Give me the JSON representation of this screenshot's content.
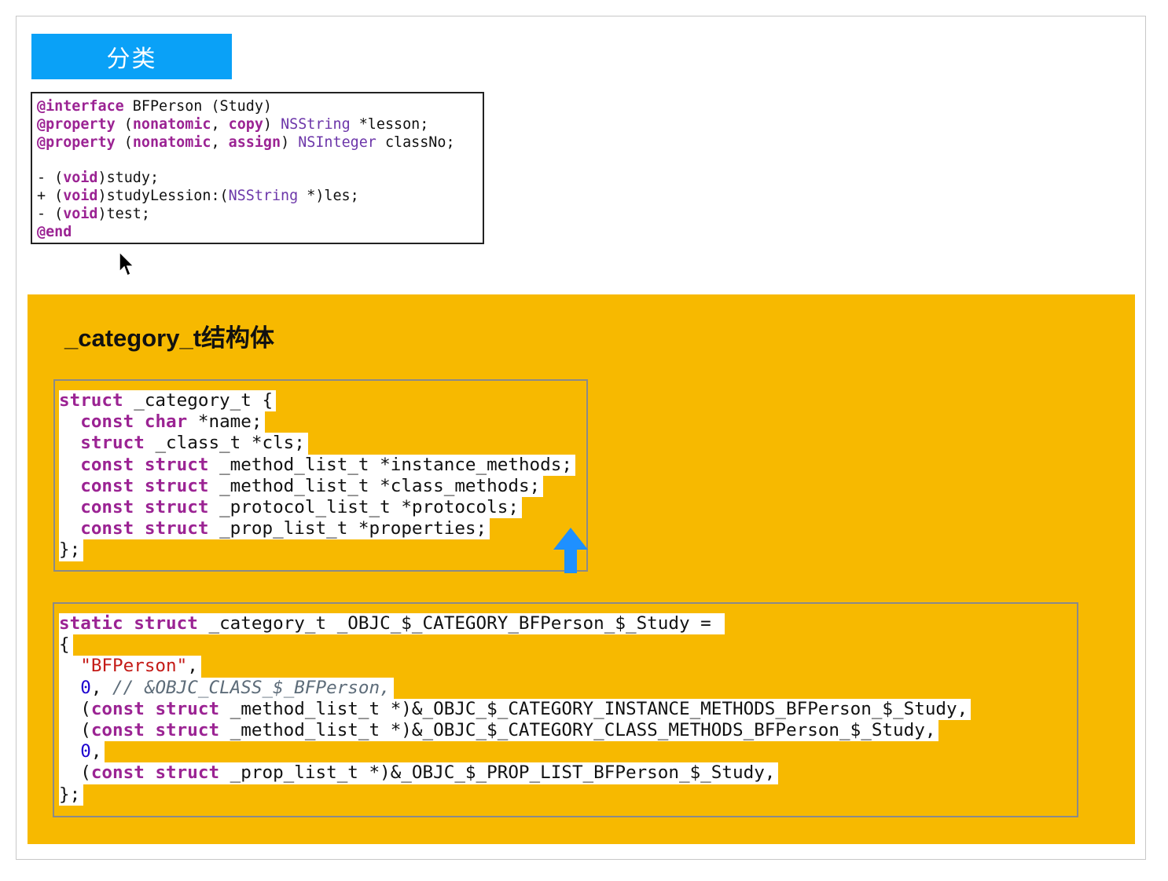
{
  "title_tag": "分类",
  "interface_code": [
    [
      {
        "t": "@interface",
        "c": "kw"
      },
      {
        "t": " BFPerson (Study)",
        "c": ""
      }
    ],
    [
      {
        "t": "@property",
        "c": "kw"
      },
      {
        "t": " (",
        "c": ""
      },
      {
        "t": "nonatomic",
        "c": "kw"
      },
      {
        "t": ", ",
        "c": ""
      },
      {
        "t": "copy",
        "c": "kw"
      },
      {
        "t": ") ",
        "c": ""
      },
      {
        "t": "NSString",
        "c": "ty"
      },
      {
        "t": " *lesson;",
        "c": ""
      }
    ],
    [
      {
        "t": "@property",
        "c": "kw"
      },
      {
        "t": " (",
        "c": ""
      },
      {
        "t": "nonatomic",
        "c": "kw"
      },
      {
        "t": ", ",
        "c": ""
      },
      {
        "t": "assign",
        "c": "kw"
      },
      {
        "t": ") ",
        "c": ""
      },
      {
        "t": "NSInteger",
        "c": "ty"
      },
      {
        "t": " classNo;",
        "c": ""
      }
    ],
    [],
    [
      {
        "t": "- (",
        "c": ""
      },
      {
        "t": "void",
        "c": "kw"
      },
      {
        "t": ")study;",
        "c": ""
      }
    ],
    [
      {
        "t": "+ (",
        "c": ""
      },
      {
        "t": "void",
        "c": "kw"
      },
      {
        "t": ")studyLession:(",
        "c": ""
      },
      {
        "t": "NSString",
        "c": "ty"
      },
      {
        "t": " *)les;",
        "c": ""
      }
    ],
    [
      {
        "t": "- (",
        "c": ""
      },
      {
        "t": "void",
        "c": "kw"
      },
      {
        "t": ")test;",
        "c": ""
      }
    ],
    [
      {
        "t": "@end",
        "c": "kw"
      }
    ]
  ],
  "panel_title": "_category_t结构体",
  "struct_code": [
    [
      {
        "t": "struct",
        "c": "kw"
      },
      {
        "t": " _category_t {",
        "c": ""
      }
    ],
    [
      {
        "t": "  ",
        "c": ""
      },
      {
        "t": "const",
        "c": "kw"
      },
      {
        "t": " ",
        "c": ""
      },
      {
        "t": "char",
        "c": "kw"
      },
      {
        "t": " *name;",
        "c": ""
      }
    ],
    [
      {
        "t": "  ",
        "c": ""
      },
      {
        "t": "struct",
        "c": "kw"
      },
      {
        "t": " _class_t *cls;",
        "c": ""
      }
    ],
    [
      {
        "t": "  ",
        "c": ""
      },
      {
        "t": "const",
        "c": "kw"
      },
      {
        "t": " ",
        "c": ""
      },
      {
        "t": "struct",
        "c": "kw"
      },
      {
        "t": " _method_list_t *instance_methods;",
        "c": ""
      }
    ],
    [
      {
        "t": "  ",
        "c": ""
      },
      {
        "t": "const",
        "c": "kw"
      },
      {
        "t": " ",
        "c": ""
      },
      {
        "t": "struct",
        "c": "kw"
      },
      {
        "t": " _method_list_t *class_methods;",
        "c": ""
      }
    ],
    [
      {
        "t": "  ",
        "c": ""
      },
      {
        "t": "const",
        "c": "kw"
      },
      {
        "t": " ",
        "c": ""
      },
      {
        "t": "struct",
        "c": "kw"
      },
      {
        "t": " _protocol_list_t *protocols;",
        "c": ""
      }
    ],
    [
      {
        "t": "  ",
        "c": ""
      },
      {
        "t": "const",
        "c": "kw"
      },
      {
        "t": " ",
        "c": ""
      },
      {
        "t": "struct",
        "c": "kw"
      },
      {
        "t": " _prop_list_t *properties;",
        "c": ""
      }
    ],
    [
      {
        "t": "};",
        "c": ""
      }
    ]
  ],
  "instance_code": [
    [
      {
        "t": "static",
        "c": "kw"
      },
      {
        "t": " ",
        "c": ""
      },
      {
        "t": "struct",
        "c": "kw"
      },
      {
        "t": " _category_t _OBJC_$_CATEGORY_BFPerson_$_Study = ",
        "c": ""
      }
    ],
    [
      {
        "t": "{",
        "c": ""
      }
    ],
    [
      {
        "t": "  ",
        "c": ""
      },
      {
        "t": "\"BFPerson\"",
        "c": "str"
      },
      {
        "t": ",",
        "c": ""
      }
    ],
    [
      {
        "t": "  ",
        "c": ""
      },
      {
        "t": "0",
        "c": "num"
      },
      {
        "t": ", ",
        "c": ""
      },
      {
        "t": "// &OBJC_CLASS_$_BFPerson,",
        "c": "cm"
      }
    ],
    [
      {
        "t": "  (",
        "c": ""
      },
      {
        "t": "const",
        "c": "kw"
      },
      {
        "t": " ",
        "c": ""
      },
      {
        "t": "struct",
        "c": "kw"
      },
      {
        "t": " _method_list_t *)&_OBJC_$_CATEGORY_INSTANCE_METHODS_BFPerson_$_Study,",
        "c": ""
      }
    ],
    [
      {
        "t": "  (",
        "c": ""
      },
      {
        "t": "const",
        "c": "kw"
      },
      {
        "t": " ",
        "c": ""
      },
      {
        "t": "struct",
        "c": "kw"
      },
      {
        "t": " _method_list_t *)&_OBJC_$_CATEGORY_CLASS_METHODS_BFPerson_$_Study,",
        "c": ""
      }
    ],
    [
      {
        "t": "  ",
        "c": ""
      },
      {
        "t": "0",
        "c": "num"
      },
      {
        "t": ",",
        "c": ""
      }
    ],
    [
      {
        "t": "  (",
        "c": ""
      },
      {
        "t": "const",
        "c": "kw"
      },
      {
        "t": " ",
        "c": ""
      },
      {
        "t": "struct",
        "c": "kw"
      },
      {
        "t": " _prop_list_t *)&_OBJC_$_PROP_LIST_BFPerson_$_Study,",
        "c": ""
      }
    ],
    [
      {
        "t": "};",
        "c": ""
      }
    ]
  ],
  "colors": {
    "title_tag_bg": "#0aa1f7",
    "panel_bg": "#f7b900",
    "keyword": "#9b2393",
    "type": "#6c36a9",
    "string": "#c41a16",
    "number": "#1c00cf",
    "comment": "#5d6c79",
    "arrow": "#1e90ff"
  },
  "icons": {
    "cursor": "mouse-pointer-icon",
    "arrow": "up-arrow-icon"
  }
}
